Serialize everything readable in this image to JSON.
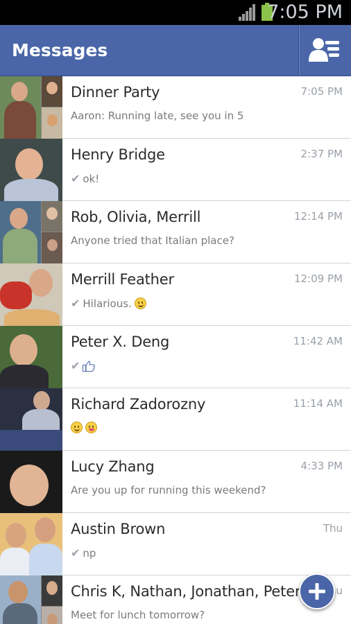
{
  "status_bar": {
    "time": "7:05 PM",
    "icons": [
      "signal-icon",
      "battery-icon"
    ]
  },
  "header": {
    "title": "Messages",
    "action_icon": "friends-list-icon"
  },
  "conversations": [
    {
      "name": "Dinner Party",
      "time": "7:05 PM",
      "snippet": "Aaron: Running late, see you in 5",
      "sent": false,
      "group": true
    },
    {
      "name": "Henry Bridge",
      "time": "2:37 PM",
      "snippet": "ok!",
      "sent": true,
      "group": false
    },
    {
      "name": "Rob, Olivia, Merrill",
      "time": "12:14 PM",
      "snippet": "Anyone tried that Italian place?",
      "sent": false,
      "group": true
    },
    {
      "name": "Merrill Feather",
      "time": "12:09 PM",
      "snippet": "Hilarious.",
      "sent": true,
      "group": false,
      "emoji": "laughing-emoji"
    },
    {
      "name": "Peter X. Deng",
      "time": "11:42 AM",
      "snippet": "",
      "sent": true,
      "group": false,
      "emoji": "thumbs-up-icon"
    },
    {
      "name": "Richard Zadorozny",
      "time": "11:14 AM",
      "snippet": "",
      "sent": false,
      "group": false,
      "emoji": "wink-and-tongue-emoji"
    },
    {
      "name": "Lucy Zhang",
      "time": "4:33 PM",
      "snippet": "Are you up for running this weekend?",
      "sent": false,
      "group": false
    },
    {
      "name": "Austin Brown",
      "time": "Thu",
      "snippet": "np",
      "sent": true,
      "group": false
    },
    {
      "name": "Chris K, Nathan, Jonathan, Peter",
      "time": "Thu",
      "snippet": "Meet for lunch tomorrow?",
      "sent": false,
      "group": true
    }
  ],
  "fab": {
    "icon": "plus-icon"
  },
  "colors": {
    "accent": "#4a66a8",
    "battery": "#8bc34a"
  }
}
